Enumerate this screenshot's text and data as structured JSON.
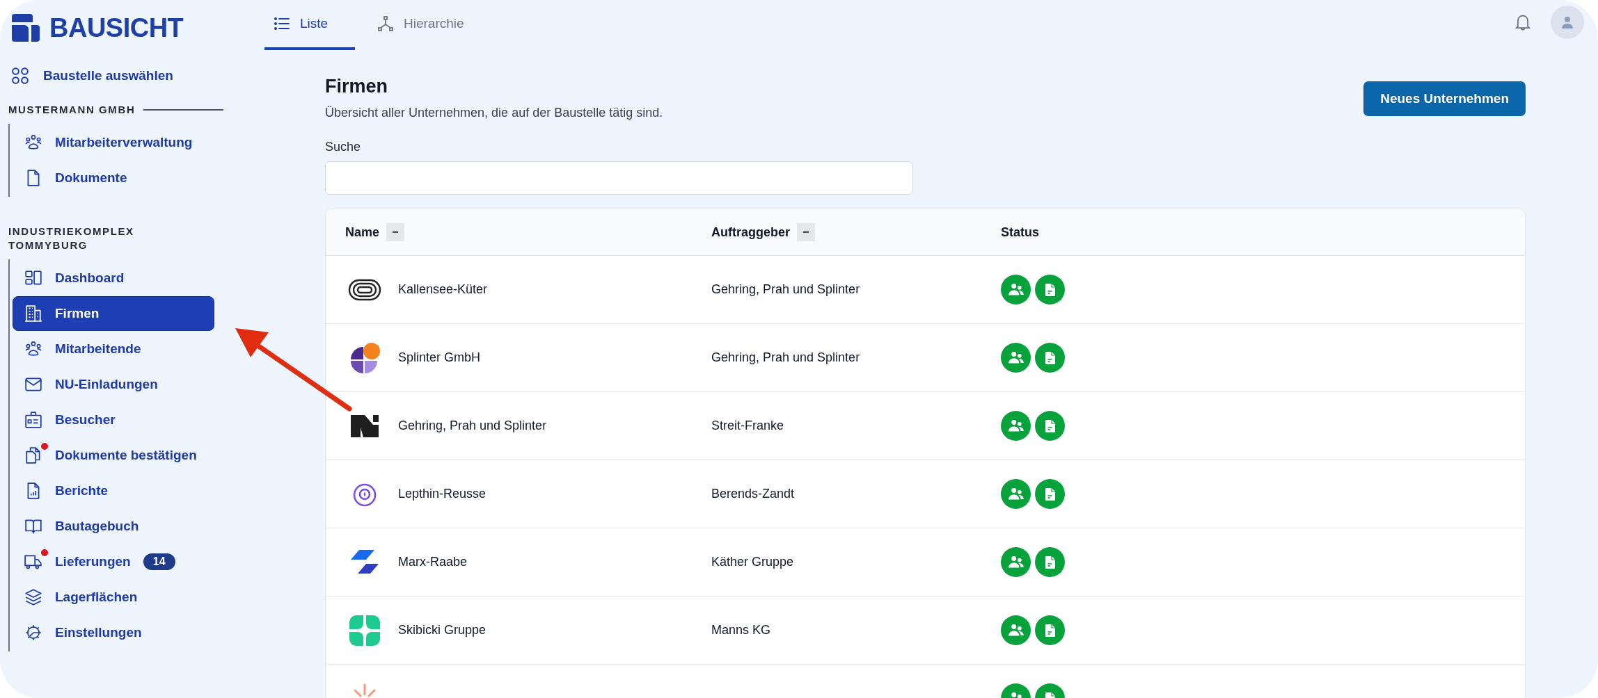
{
  "logo": {
    "text": "BAUSICHT"
  },
  "tabs": [
    {
      "label": "Liste",
      "selected": true
    },
    {
      "label": "Hierarchie",
      "selected": false
    }
  ],
  "sidebar": {
    "top_item": {
      "label": "Baustelle auswählen"
    },
    "groups": [
      {
        "heading": "MUSTERMANN GMBH",
        "items": [
          {
            "label": "Mitarbeiterverwaltung",
            "selected": false,
            "notify": false
          },
          {
            "label": "Dokumente",
            "selected": false,
            "notify": false
          }
        ]
      },
      {
        "heading": "INDUSTRIEKOMPLEX TOMMYBURG",
        "items": [
          {
            "label": "Dashboard",
            "selected": false,
            "notify": false
          },
          {
            "label": "Firmen",
            "selected": true,
            "notify": false
          },
          {
            "label": "Mitarbeitende",
            "selected": false,
            "notify": false
          },
          {
            "label": "NU-Einladungen",
            "selected": false,
            "notify": false
          },
          {
            "label": "Besucher",
            "selected": false,
            "notify": false
          },
          {
            "label": "Dokumente bestätigen",
            "selected": false,
            "notify": true
          },
          {
            "label": "Berichte",
            "selected": false,
            "notify": false
          },
          {
            "label": "Bautagebuch",
            "selected": false,
            "notify": false
          },
          {
            "label": "Lieferungen",
            "selected": false,
            "notify": true,
            "count": "14"
          },
          {
            "label": "Lagerflächen",
            "selected": false,
            "notify": false
          },
          {
            "label": "Einstellungen",
            "selected": false,
            "notify": false
          }
        ]
      }
    ]
  },
  "page": {
    "title": "Firmen",
    "subtitle": "Übersicht aller Unternehmen, die auf der Baustelle tätig sind.",
    "button": "Neues Unternehmen",
    "search": {
      "label": "Suche"
    }
  },
  "table": {
    "columns": [
      {
        "label": "Name",
        "toggle": "−"
      },
      {
        "label": "Auftraggeber",
        "toggle": "−"
      },
      {
        "label": "Status"
      }
    ],
    "rows": [
      {
        "name": "Kallensee-Küter",
        "client": "Gehring, Prah und Splinter",
        "status": [
          {
            "kind": "team",
            "ok": true
          },
          {
            "kind": "documents",
            "ok": true
          }
        ]
      },
      {
        "name": "Splinter GmbH",
        "client": "Gehring, Prah und Splinter",
        "status": [
          {
            "kind": "team",
            "ok": true
          },
          {
            "kind": "documents",
            "ok": true
          }
        ]
      },
      {
        "name": "Gehring, Prah und Splinter",
        "client": "Streit-Franke",
        "status": [
          {
            "kind": "team",
            "ok": true
          },
          {
            "kind": "documents",
            "ok": true
          }
        ]
      },
      {
        "name": "Lepthin-Reusse",
        "client": "Berends-Zandt",
        "status": [
          {
            "kind": "team",
            "ok": true
          },
          {
            "kind": "documents",
            "ok": true
          }
        ]
      },
      {
        "name": "Marx-Raabe",
        "client": "Käther Gruppe",
        "status": [
          {
            "kind": "team",
            "ok": true
          },
          {
            "kind": "documents",
            "ok": true
          }
        ]
      },
      {
        "name": "Skibicki Gruppe",
        "client": "Manns KG",
        "status": [
          {
            "kind": "team",
            "ok": true
          },
          {
            "kind": "documents",
            "ok": true
          }
        ]
      },
      {
        "status": [
          {
            "kind": "team",
            "ok": true
          },
          {
            "kind": "documents",
            "ok": true
          }
        ]
      }
    ]
  },
  "annotations": [
    {
      "kind": "arrow"
    }
  ]
}
